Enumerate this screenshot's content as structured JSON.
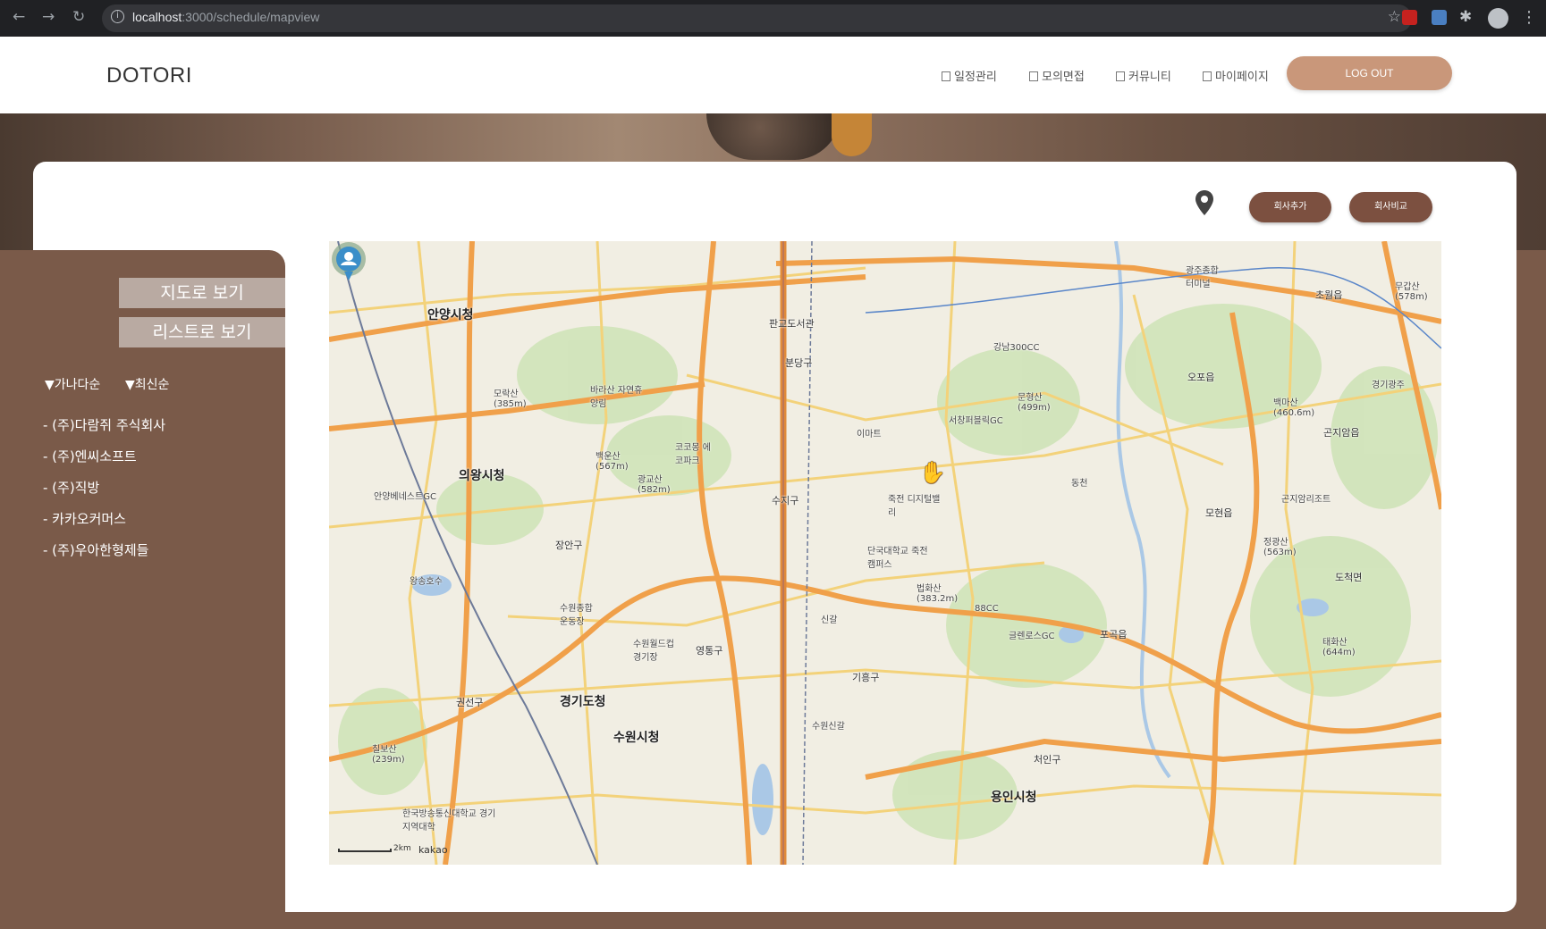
{
  "browser": {
    "url_host": "localhost",
    "url_path": ":3000/schedule/mapview",
    "extension_colors": [
      "#c5221f",
      "#4a7fc1"
    ]
  },
  "header": {
    "logo": "DOTORI",
    "menu": [
      {
        "label": "일정관리",
        "icon": "calendar-icon"
      },
      {
        "label": "모의면접",
        "icon": "document-icon"
      },
      {
        "label": "커뮤니티",
        "icon": "community-icon"
      },
      {
        "label": "마이페이지",
        "icon": "user-page-icon"
      }
    ],
    "logout_label": "LOG OUT"
  },
  "toolbar": {
    "add_company_label": "회사추가",
    "compare_company_label": "회사비교"
  },
  "sidebar": {
    "map_view_label": "지도로 보기",
    "list_view_label": "리스트로 보기",
    "sort_alpha": "▼가나다순",
    "sort_recent": "▼최신순",
    "companies": [
      "- (주)다람쥐 주식회사",
      "- (주)엔씨소프트",
      "- (주)직방",
      "- 카카오커머스",
      "- (주)우아한형제들"
    ]
  },
  "map": {
    "attribution": "kakao",
    "scale": "2km",
    "labels": [
      {
        "text": "안양시청",
        "big": true
      },
      {
        "text": "의왕시청",
        "big": true
      },
      {
        "text": "경기도청",
        "big": true
      },
      {
        "text": "수원시청",
        "big": true
      },
      {
        "text": "용인시청",
        "big": true
      },
      {
        "text": "판교도서관"
      },
      {
        "text": "분당구"
      },
      {
        "text": "수지구"
      },
      {
        "text": "장안구"
      },
      {
        "text": "영통구"
      },
      {
        "text": "기흥구"
      },
      {
        "text": "권선구"
      },
      {
        "text": "처인구"
      },
      {
        "text": "이마트"
      },
      {
        "text": "단국대학교 죽전캠퍼스"
      },
      {
        "text": "백운산 (567m)"
      },
      {
        "text": "광교산 (582m)"
      },
      {
        "text": "모락산 (385m)"
      },
      {
        "text": "문형산 (499m)"
      },
      {
        "text": "백마산 (460.6m)"
      },
      {
        "text": "법화산 (383.2m)"
      },
      {
        "text": "태화산 (644m)"
      },
      {
        "text": "정광산 (563m)"
      },
      {
        "text": "칠보산 (239m)"
      },
      {
        "text": "바라산 자연휴양림"
      },
      {
        "text": "코코몽 에코파크"
      },
      {
        "text": "서창퍼블릭GC"
      },
      {
        "text": "강남300CC"
      },
      {
        "text": "곤지암리조트"
      },
      {
        "text": "글렌로스GC"
      },
      {
        "text": "88CC"
      },
      {
        "text": "수원종합 운동장"
      },
      {
        "text": "수원월드컵 경기장"
      },
      {
        "text": "안양베네스트GC"
      },
      {
        "text": "광주종합 터미널"
      },
      {
        "text": "오포읍"
      },
      {
        "text": "모현읍"
      },
      {
        "text": "포곡읍"
      },
      {
        "text": "곤지암읍"
      },
      {
        "text": "도척면"
      },
      {
        "text": "초월읍"
      },
      {
        "text": "무갑산 (578m)"
      },
      {
        "text": "경기광주"
      },
      {
        "text": "신갈"
      },
      {
        "text": "수원신갈"
      },
      {
        "text": "동천"
      },
      {
        "text": "죽전 디지털밸리"
      },
      {
        "text": "왕송호수"
      },
      {
        "text": "한국방송통신대학교 경기지역대학"
      }
    ]
  }
}
